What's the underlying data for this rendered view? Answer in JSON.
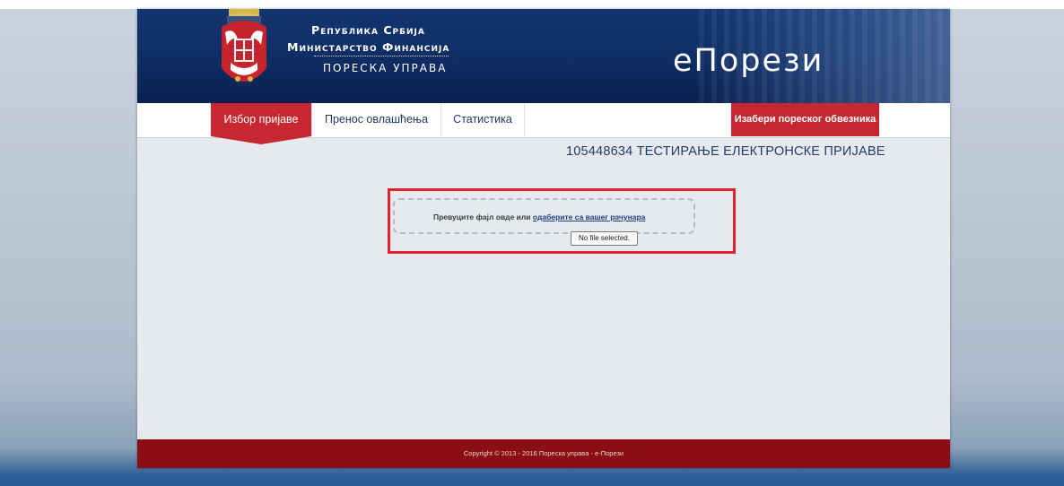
{
  "header": {
    "line1": "Република Србија",
    "line2": "Министарство Финансија",
    "line3": "ПОРЕСКА УПРАВА",
    "logo_text": "еПорези",
    "crest_icon": "serbian-coat-of-arms-icon"
  },
  "nav": {
    "items": [
      {
        "label": "Избор пријаве",
        "active": true
      },
      {
        "label": "Пренос овлашћења",
        "active": false
      },
      {
        "label": "Статистика",
        "active": false
      }
    ],
    "taxpayer_button": "Изабери пореског обвезника"
  },
  "main": {
    "company_title": "105448634 ТЕСТИРАЊЕ ЕЛЕКТРОНСКЕ ПРИЈАВЕ",
    "dropzone": {
      "text": "Превуците фајл овде или",
      "link": "одаберите са вашег рачунара",
      "file_status": "No file selected."
    }
  },
  "footer": {
    "copyright": "Copyright © 2013 - 2016 Пореска управа - е-Порези"
  },
  "colors": {
    "header_blue": "#0f2f66",
    "accent_red": "#c62730",
    "footer_red": "#8a0e13",
    "highlight_red": "#e32230"
  }
}
